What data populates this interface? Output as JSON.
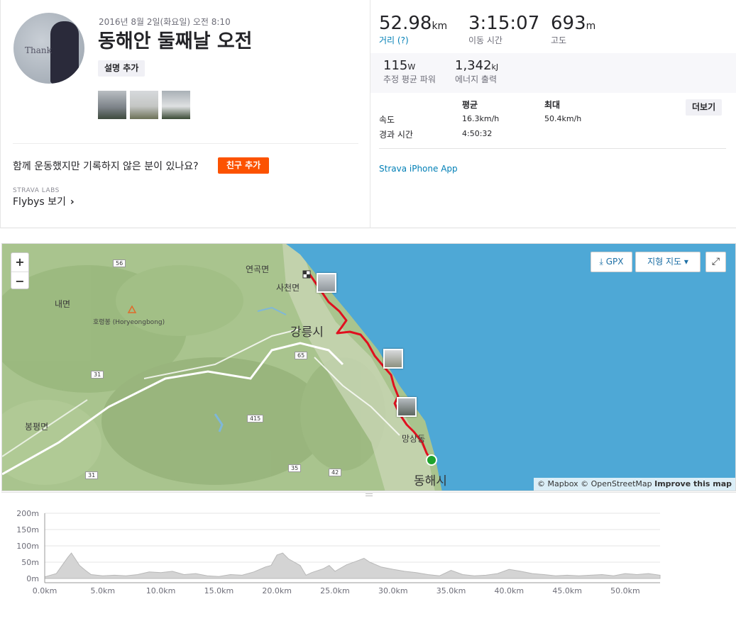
{
  "activity": {
    "date": "2016년 8월 2일(화요일) 오전 8:10",
    "title": "동해안 둘째날 오전",
    "add_description": "설명 추가",
    "avatar_text": "Thank"
  },
  "friends": {
    "question": "함께 운동했지만 기록하지 않은 분이 있나요?",
    "add_friend": "친구 추가"
  },
  "labs": {
    "label": "STRAVA LABS",
    "flybys": "Flybys 보기"
  },
  "stats": {
    "distance": {
      "value": "52.98",
      "unit": "km",
      "label": "거리 (?)"
    },
    "moving_time": {
      "value": "3:15:07",
      "label": "이동 시간"
    },
    "elevation": {
      "value": "693",
      "unit": "m",
      "label": "고도"
    },
    "power": {
      "value": "115",
      "unit": "W",
      "label": "추정 평균 파워"
    },
    "energy": {
      "value": "1,342",
      "unit": "kJ",
      "label": "에너지 출력"
    }
  },
  "table": {
    "col_avg": "평균",
    "col_max": "최대",
    "more": "더보기",
    "rows": [
      {
        "label": "속도",
        "avg": "16.3km/h",
        "max": "50.4km/h"
      },
      {
        "label": "경과 시간",
        "avg": "4:50:32",
        "max": ""
      }
    ]
  },
  "device": "Strava iPhone App",
  "map": {
    "zoom_in": "+",
    "zoom_out": "−",
    "gpx": "GPX",
    "terrain": "지형 지도 ▾",
    "attribution_1": "© Mapbox © OpenStreetMap",
    "attribution_2": "Improve this map",
    "places": [
      {
        "name": "연곡면"
      },
      {
        "name": "사천면"
      },
      {
        "name": "내면"
      },
      {
        "name": "호령봉 (Horyeongbong)"
      },
      {
        "name": "강릉시"
      },
      {
        "name": "봉평면"
      },
      {
        "name": "망상동"
      },
      {
        "name": "동해시"
      }
    ],
    "roads": [
      "56",
      "65",
      "31",
      "415",
      "35",
      "42",
      "31"
    ],
    "colors": {
      "route": "#e0101f",
      "start": "#1fa32e",
      "sea": "#4ea8d6"
    }
  },
  "elevation_chart": {
    "y_labels": [
      "200m",
      "150m",
      "100m",
      "50m",
      "0m"
    ],
    "x_labels": [
      "0.0km",
      "5.0km",
      "10.0km",
      "15.0km",
      "20.0km",
      "25.0km",
      "30.0km",
      "35.0km",
      "40.0km",
      "45.0km",
      "50.0km"
    ]
  },
  "chart_data": {
    "type": "area",
    "xlabel": "",
    "ylabel": "",
    "ylim": [
      0,
      200
    ],
    "xlim": [
      0,
      53
    ],
    "x": [
      0,
      1,
      1.5,
      2,
      2.3,
      2.6,
      3,
      3.5,
      4,
      5,
      6,
      7,
      8,
      9,
      10,
      11,
      12,
      13,
      14,
      15,
      16,
      17,
      18,
      19,
      19.5,
      20,
      20.5,
      21,
      22,
      22.5,
      23,
      24,
      24.5,
      25,
      26,
      27,
      27.5,
      28,
      29,
      30,
      31,
      32,
      33,
      34,
      35,
      36,
      37,
      38,
      39,
      40,
      41,
      42,
      43,
      44,
      45,
      46,
      47,
      48,
      49,
      50,
      51,
      52,
      53
    ],
    "series": [
      {
        "values": [
          5,
          15,
          40,
          65,
          78,
          62,
          40,
          25,
          12,
          8,
          10,
          8,
          12,
          20,
          18,
          22,
          12,
          15,
          8,
          6,
          12,
          10,
          20,
          35,
          40,
          72,
          78,
          60,
          40,
          10,
          18,
          30,
          40,
          22,
          42,
          55,
          62,
          50,
          35,
          28,
          22,
          18,
          12,
          8,
          25,
          12,
          8,
          10,
          15,
          28,
          22,
          15,
          12,
          8,
          10,
          8,
          10,
          12,
          8,
          15,
          12,
          15,
          10
        ]
      }
    ]
  }
}
